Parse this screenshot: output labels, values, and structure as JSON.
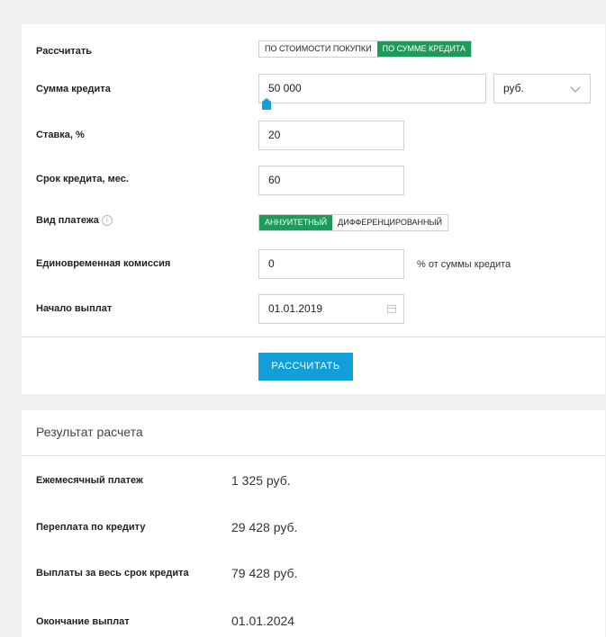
{
  "form": {
    "calculate_label": "Рассчитать",
    "calc_mode_options": [
      "ПО СТОИМОСТИ ПОКУПКИ",
      "ПО СУММЕ КРЕДИТА"
    ],
    "loan_amount_label": "Сумма кредита",
    "loan_amount_value": "50 000",
    "currency_value": "руб.",
    "rate_label": "Ставка, %",
    "rate_value": "20",
    "term_label": "Срок кредита, мес.",
    "term_value": "60",
    "payment_type_label": "Вид платежа",
    "payment_type_options": [
      "АННУИТЕТНЫЙ",
      "ДИФФЕРЕНЦИРОВАННЫЙ"
    ],
    "commission_label": "Единовременная комиссия",
    "commission_value": "0",
    "commission_suffix": "% от суммы кредита",
    "start_label": "Начало выплат",
    "start_value": "01.01.2019",
    "submit_label": "РАССЧИТАТЬ",
    "info_icon_glyph": "i"
  },
  "result": {
    "title": "Результат расчета",
    "monthly_payment_label": "Ежемесячный платеж",
    "monthly_payment_value": "1 325 руб.",
    "overpayment_label": "Переплата по кредиту",
    "overpayment_value": "29 428 руб.",
    "total_label": "Выплаты за весь срок кредита",
    "total_value": "79 428 руб.",
    "end_label": "Окончание выплат",
    "end_value": "01.01.2024"
  },
  "colors": {
    "accent_green": "#1e9a5a",
    "accent_blue": "#109fd8",
    "slider_thumb": "#109fd8"
  },
  "icons": [
    "info-icon",
    "chevron-down-icon",
    "calendar-icon",
    "slider-thumb-icon"
  ]
}
